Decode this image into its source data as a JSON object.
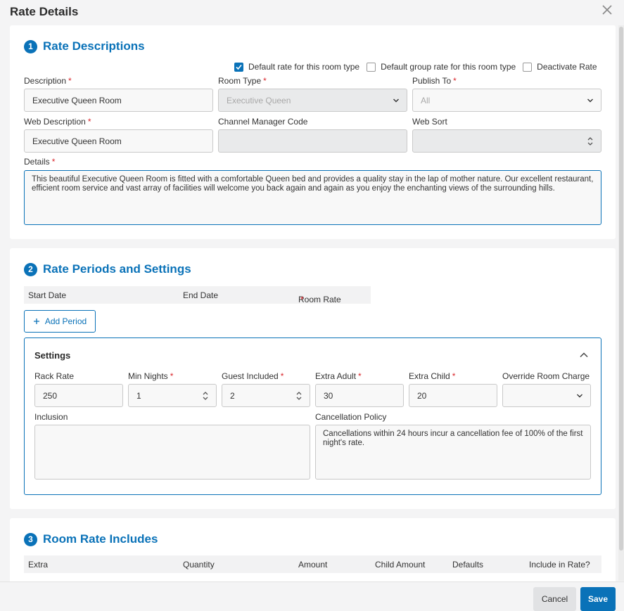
{
  "modal": {
    "title": "Rate Details"
  },
  "section1": {
    "number": "1",
    "title": "Rate Descriptions",
    "checkboxes": [
      {
        "label": "Default rate for this room type",
        "checked": true
      },
      {
        "label": "Default group rate for this room type",
        "checked": false
      },
      {
        "label": "Deactivate Rate",
        "checked": false
      }
    ],
    "description": {
      "label": "Description",
      "value": "Executive Queen Room"
    },
    "room_type": {
      "label": "Room Type",
      "value": "Executive Queen"
    },
    "publish_to": {
      "label": "Publish To",
      "value": "All"
    },
    "web_description": {
      "label": "Web Description",
      "value": "Executive Queen Room"
    },
    "channel_manager_code": {
      "label": "Channel Manager Code",
      "value": ""
    },
    "web_sort": {
      "label": "Web Sort",
      "value": ""
    },
    "details": {
      "label": "Details",
      "value": "This beautiful Executive Queen Room is fitted with a comfortable Queen bed and provides a quality stay in the lap of mother nature. Our excellent restaurant, efficient room service and vast array of facilities will welcome you back again and again as you enjoy the enchanting views of the surrounding hills."
    }
  },
  "section2": {
    "number": "2",
    "title": "Rate Periods and Settings",
    "columns": {
      "start": "Start Date",
      "end": "End Date",
      "rate": "Room Rate"
    },
    "add_period_label": "Add Period",
    "settings": {
      "title": "Settings",
      "rack_rate": {
        "label": "Rack Rate",
        "value": "250"
      },
      "min_nights": {
        "label": "Min Nights",
        "value": "1"
      },
      "guest_included": {
        "label": "Guest Included",
        "value": "2"
      },
      "extra_adult": {
        "label": "Extra Adult",
        "value": "30"
      },
      "extra_child": {
        "label": "Extra Child",
        "value": "20"
      },
      "override_room_charge": {
        "label": "Override Room Charge",
        "value": ""
      },
      "inclusion": {
        "label": "Inclusion",
        "value": ""
      },
      "cancellation_policy": {
        "label": "Cancellation Policy",
        "value": "Cancellations within 24 hours incur a cancellation fee of 100% of the first night's rate."
      }
    }
  },
  "section3": {
    "number": "3",
    "title": "Room Rate Includes",
    "columns": {
      "extra": "Extra",
      "quantity": "Quantity",
      "amount": "Amount",
      "child_amount": "Child Amount",
      "defaults": "Defaults",
      "include": "Include in Rate?"
    }
  },
  "required_mark": "*",
  "footer": {
    "cancel_label": "Cancel",
    "save_label": "Save"
  },
  "colors": {
    "accent": "#0a72b8",
    "required": "#d9262c"
  }
}
